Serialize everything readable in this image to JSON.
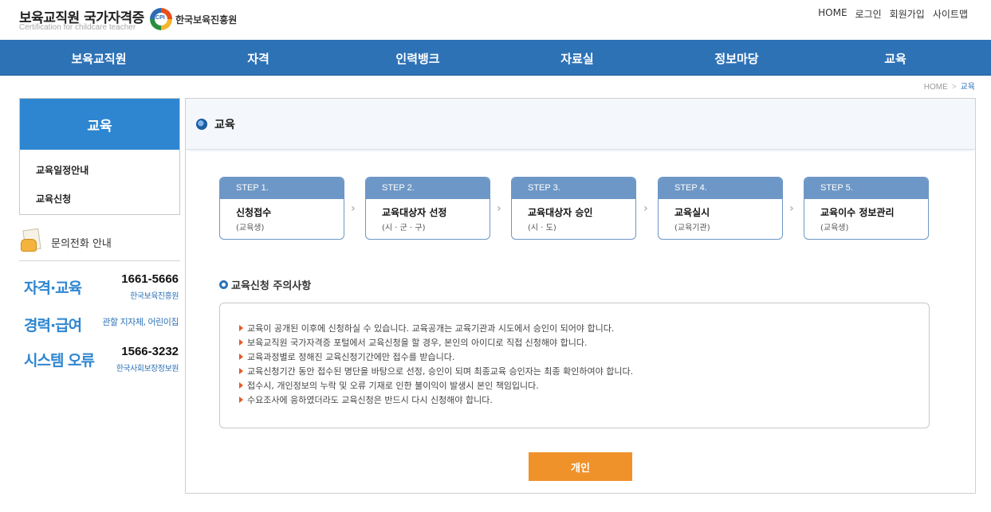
{
  "header": {
    "logo_main": "보육교직원 국가자격증",
    "logo_sub": "Certification for childcare teacher",
    "org_emblem_text": "KCPI",
    "org_name": "한국보육진흥원",
    "util_nav": [
      "HOME",
      "로그인",
      "회원가입",
      "사이트맵"
    ]
  },
  "gnb": {
    "items": [
      "보육교직원",
      "자격",
      "인력뱅크",
      "자료실",
      "정보마당",
      "교육"
    ]
  },
  "breadcrumb": {
    "home": "HOME",
    "separator": ">",
    "current": "교육"
  },
  "sidebar": {
    "title": "교육",
    "items": [
      "교육일정안내",
      "교육신청"
    ]
  },
  "contact": {
    "title": "문의전화 안내",
    "rows": [
      {
        "label": "자격·교육",
        "phone": "1661-5666",
        "org": "한국보육진흥원"
      },
      {
        "label": "경력·급여",
        "note": "관할 지자체, 어린이집"
      },
      {
        "label": "시스템 오류",
        "phone": "1566-3232",
        "org": "한국사회보장정보원"
      }
    ]
  },
  "content": {
    "title": "교육",
    "steps": [
      {
        "num": "STEP 1.",
        "name": "신청접수",
        "sub": "(교육생)"
      },
      {
        "num": "STEP 2.",
        "name": "교육대상자 선정",
        "sub": "(시 · 군 · 구)"
      },
      {
        "num": "STEP 3.",
        "name": "교육대상자 승인",
        "sub": "(시 · 도)"
      },
      {
        "num": "STEP 4.",
        "name": "교육실시",
        "sub": "(교육기관)"
      },
      {
        "num": "STEP 5.",
        "name": "교육이수 정보관리",
        "sub": "(교육생)"
      }
    ],
    "step_arrow": "›",
    "notice_title": "교육신청 주의사항",
    "notices": [
      "교육이 공개된 이후에 신청하실 수 있습니다. 교육공개는 교육기관과 시도에서 승인이 되어야 합니다.",
      "보육교직원 국가자격증 포털에서 교육신청을 할 경우, 본인의 아이디로 직접 신청해야 합니다.",
      "교육과정별로 정해진 교육신청기간에만 접수를 받습니다.",
      "교육신청기간 동안 접수된 명단을 바탕으로 선정, 승인이 되며 최종교육 승인자는 최종 확인하여야 합니다.",
      "접수시, 개인정보의 누락 및 오류 기재로 인한 불이익이 발생시 본인 책임입니다.",
      "수요조사에 응하였더라도 교육신청은 반드시 다시 신청해야 합니다."
    ],
    "button_label": "개인"
  },
  "colors": {
    "brand_blue": "#2e72b6",
    "side_blue": "#2e86d1",
    "step_blue": "#6d97c6",
    "button_orange": "#f0922a",
    "notice_marker": "#e2592b"
  }
}
